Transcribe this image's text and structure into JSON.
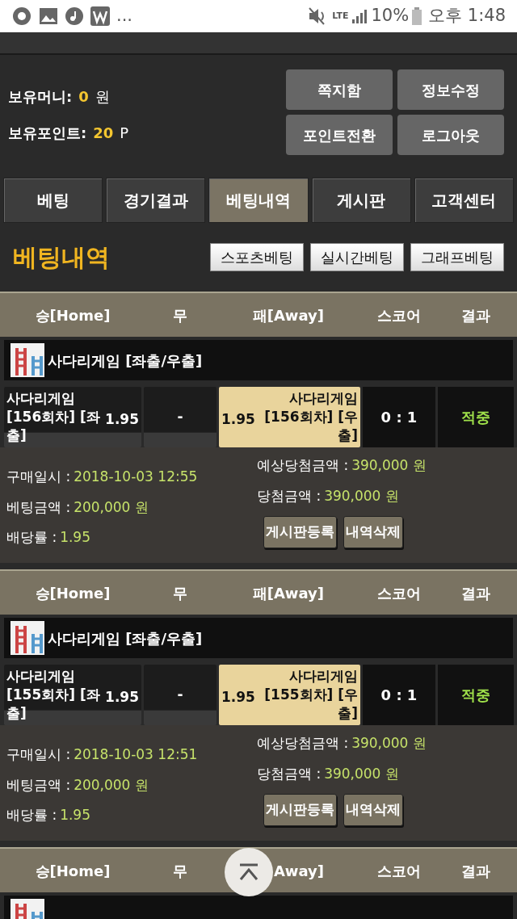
{
  "status_bar": {
    "more": "...",
    "network": "LTE",
    "battery": "10%",
    "time": "오후 1:48"
  },
  "account": {
    "money_label": "보유머니:",
    "money": "0",
    "money_unit": "원",
    "points_label": "보유포인트:",
    "points": "20",
    "points_unit": "P"
  },
  "account_buttons": [
    "쪽지함",
    "정보수정",
    "포인트전환",
    "로그아웃"
  ],
  "tabs": [
    {
      "label": "베팅",
      "selected": false
    },
    {
      "label": "경기결과",
      "selected": false
    },
    {
      "label": "베팅내역",
      "selected": true
    },
    {
      "label": "게시판",
      "selected": false
    },
    {
      "label": "고객센터",
      "selected": false
    }
  ],
  "section": {
    "title": "베팅내역",
    "filters": [
      "스포츠베팅",
      "실시간베팅",
      "그래프베팅"
    ]
  },
  "bets": [
    {
      "columns": [
        "승[Home]",
        "무",
        "패[Away]",
        "스코어",
        "결과"
      ],
      "game": "사다리게임 [좌출/우출]",
      "home": {
        "name": "사다리게임 [156회차] [좌출]",
        "odds": "1.95",
        "selected": false
      },
      "draw": {
        "name": "-",
        "selected": false
      },
      "away": {
        "name": "사다리게임 [156회차] [우출]",
        "odds": "1.95",
        "selected": true
      },
      "score": "0 : 1",
      "result": "적중",
      "details_left": [
        {
          "label": "구매일시 :",
          "value": "2018-10-03 12:55"
        },
        {
          "label": "베팅금액 :",
          "value": "200,000 원"
        },
        {
          "label": "배당률 :",
          "value": "1.95"
        }
      ],
      "details_right": [
        {
          "label": "예상당첨금액 :",
          "value": "390,000 원"
        },
        {
          "label": "당첨금액 :",
          "value": "390,000 원"
        }
      ],
      "actions": [
        "게시판등록",
        "내역삭제"
      ]
    },
    {
      "columns": [
        "승[Home]",
        "무",
        "패[Away]",
        "스코어",
        "결과"
      ],
      "game": "사다리게임 [좌출/우출]",
      "home": {
        "name": "사다리게임 [155회차] [좌출]",
        "odds": "1.95",
        "selected": false
      },
      "draw": {
        "name": "-",
        "selected": false
      },
      "away": {
        "name": "사다리게임 [155회차] [우출]",
        "odds": "1.95",
        "selected": true
      },
      "score": "0 : 1",
      "result": "적중",
      "details_left": [
        {
          "label": "구매일시 :",
          "value": "2018-10-03 12:51"
        },
        {
          "label": "베팅금액 :",
          "value": "200,000 원"
        },
        {
          "label": "배당률 :",
          "value": "1.95"
        }
      ],
      "details_right": [
        {
          "label": "예상당첨금액 :",
          "value": "390,000 원"
        },
        {
          "label": "당첨금액 :",
          "value": "390,000 원"
        }
      ],
      "actions": [
        "게시판등록",
        "내역삭제"
      ]
    },
    {
      "columns": [
        "승[Home]",
        "무",
        "Away]",
        "스코어",
        "결과"
      ]
    }
  ]
}
